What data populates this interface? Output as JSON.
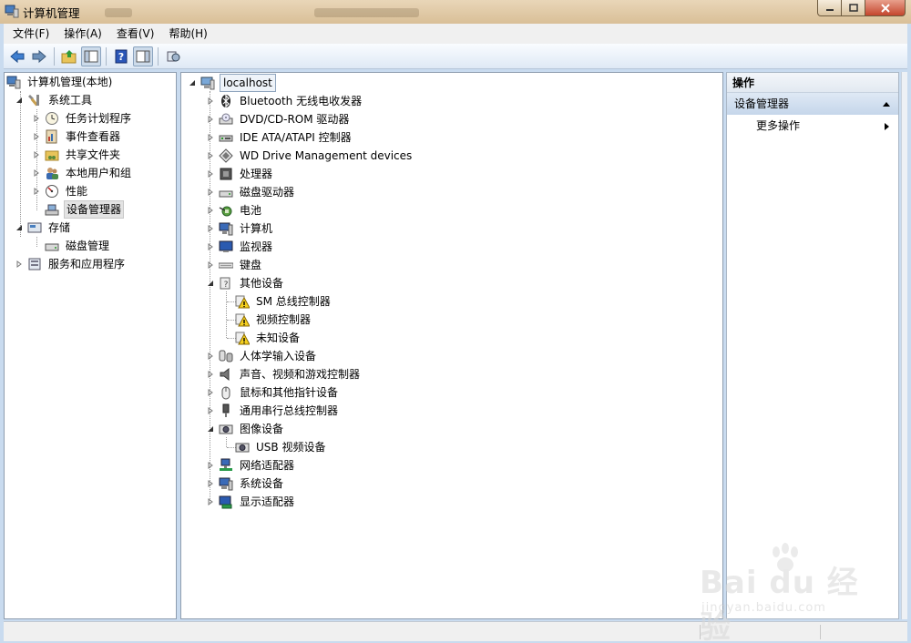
{
  "window": {
    "title": "计算机管理"
  },
  "menu": [
    "文件(F)",
    "操作(A)",
    "查看(V)",
    "帮助(H)"
  ],
  "toolbar_icons": [
    "back-arrow-icon",
    "forward-arrow-icon",
    "up-folder-icon",
    "show-hide-tree-icon",
    "help-icon",
    "action-pane-icon",
    "properties-icon"
  ],
  "left_tree": [
    {
      "label": "计算机管理(本地)",
      "icon": "computer-management-icon"
    },
    {
      "label": "系统工具",
      "icon": "tools-icon"
    },
    {
      "label": "任务计划程序",
      "icon": "clock-icon"
    },
    {
      "label": "事件查看器",
      "icon": "event-log-icon"
    },
    {
      "label": "共享文件夹",
      "icon": "shared-folder-icon"
    },
    {
      "label": "本地用户和组",
      "icon": "users-icon"
    },
    {
      "label": "性能",
      "icon": "performance-icon"
    },
    {
      "label": "设备管理器",
      "icon": "device-manager-icon"
    },
    {
      "label": "存储",
      "icon": "storage-icon"
    },
    {
      "label": "磁盘管理",
      "icon": "disk-icon"
    },
    {
      "label": "服务和应用程序",
      "icon": "services-icon"
    }
  ],
  "device_tree": {
    "root": "localhost",
    "items": [
      {
        "label": "Bluetooth 无线电收发器",
        "icon": "bluetooth-icon"
      },
      {
        "label": "DVD/CD-ROM 驱动器",
        "icon": "dvd-drive-icon"
      },
      {
        "label": "IDE ATA/ATAPI 控制器",
        "icon": "ide-controller-icon"
      },
      {
        "label": "WD Drive Management devices",
        "icon": "wd-device-icon"
      },
      {
        "label": "处理器",
        "icon": "processor-icon"
      },
      {
        "label": "磁盘驱动器",
        "icon": "disk-drive-icon"
      },
      {
        "label": "电池",
        "icon": "battery-icon"
      },
      {
        "label": "计算机",
        "icon": "computer-icon"
      },
      {
        "label": "监视器",
        "icon": "monitor-icon"
      },
      {
        "label": "键盘",
        "icon": "keyboard-icon"
      },
      {
        "label": "其他设备",
        "icon": "unknown-device-icon"
      },
      {
        "label": "SM 总线控制器",
        "icon": "warning-device-icon"
      },
      {
        "label": "视频控制器",
        "icon": "warning-device-icon"
      },
      {
        "label": "未知设备",
        "icon": "warning-device-icon"
      },
      {
        "label": "人体学输入设备",
        "icon": "hid-icon"
      },
      {
        "label": "声音、视频和游戏控制器",
        "icon": "speaker-icon"
      },
      {
        "label": "鼠标和其他指针设备",
        "icon": "mouse-icon"
      },
      {
        "label": "通用串行总线控制器",
        "icon": "usb-icon"
      },
      {
        "label": "图像设备",
        "icon": "imaging-device-icon"
      },
      {
        "label": "USB 视频设备",
        "icon": "webcam-icon"
      },
      {
        "label": "网络适配器",
        "icon": "network-adapter-icon"
      },
      {
        "label": "系统设备",
        "icon": "system-device-icon"
      },
      {
        "label": "显示适配器",
        "icon": "display-adapter-icon"
      }
    ]
  },
  "actions": {
    "header": "操作",
    "section": "设备管理器",
    "items": [
      "更多操作"
    ]
  },
  "watermark": {
    "brand": "Bai du 经验",
    "url": "jingyan.baidu.com"
  },
  "colors": {
    "title_bar": "#dcc49e",
    "selection": "#e3e3e3",
    "action_section": "#c5d6ea",
    "close_button": "#c4452d"
  }
}
